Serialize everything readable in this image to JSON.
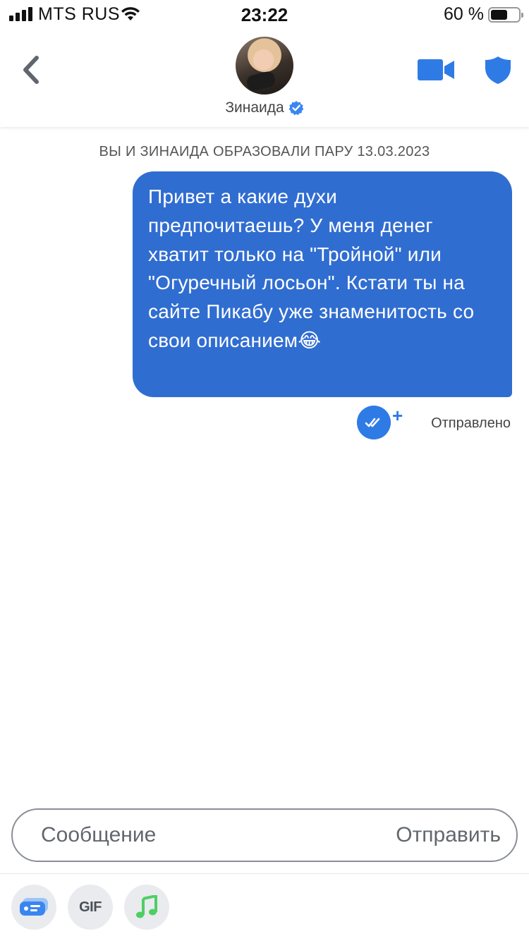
{
  "status_bar": {
    "carrier": "MTS RUS",
    "time": "23:22",
    "battery_percent": "60 %",
    "battery_level": 0.6
  },
  "header": {
    "match_name": "Зинаида",
    "verified": true,
    "icons": {
      "back": "chevron-left-icon",
      "video": "video-camera-icon",
      "safety": "shield-icon",
      "verified": "verified-badge-icon"
    }
  },
  "chat": {
    "match_notice": "ВЫ И ЗИНАИДА ОБРАЗОВАЛИ ПАРУ 13.03.2023",
    "messages": [
      {
        "from": "me",
        "text": "Привет а какие духи предпочитаешь? У меня денег хватит только на \"Тройной\" или \"Огуречный лосьон\". Кстати ты на сайте Пикабу уже знаменитость со свои описанием",
        "emoji": "😂"
      }
    ],
    "read_plus": "+",
    "status": "Отправлено"
  },
  "composer": {
    "placeholder": "Сообщение",
    "send_label": "Отправить"
  },
  "toolbar": {
    "gif_label": "GIF"
  },
  "colors": {
    "bubble": "#306dd1",
    "accent": "#2f7be6",
    "text_muted": "#555555",
    "music_green": "#4ccf63"
  }
}
